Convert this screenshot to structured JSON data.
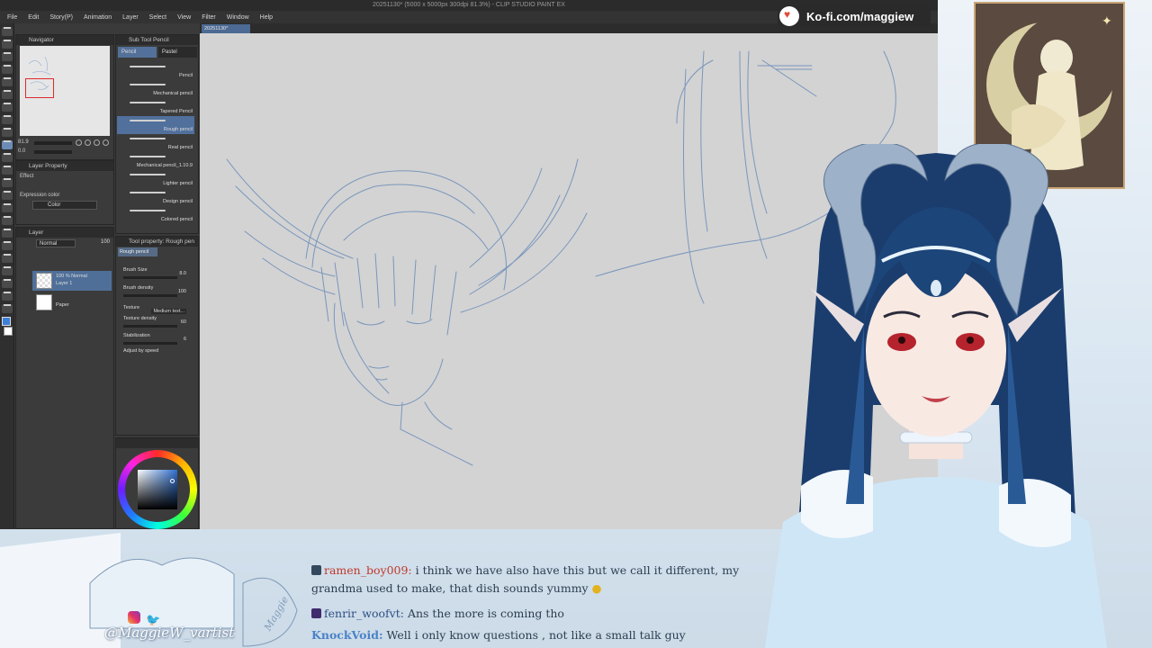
{
  "app": {
    "title": "20251130* (5000 x 5000px 300dpi 81.3%) - CLIP STUDIO PAINT EX",
    "menu": [
      "File",
      "Edit",
      "Story(P)",
      "Animation",
      "Layer",
      "Select",
      "View",
      "Filter",
      "Window",
      "Help"
    ],
    "doc_tab": "20251130*"
  },
  "navigator": {
    "title": "Navigator",
    "zoom": "81.9",
    "rotation": "0.0"
  },
  "layer_property": {
    "title": "Layer Property",
    "effect": "Effect",
    "expression_color_label": "Expression color",
    "expression_color_value": "Color"
  },
  "layer_panel": {
    "title": "Layer",
    "blend_mode": "Normal",
    "opacity": "100",
    "layers": [
      {
        "line1": "100 % Normal",
        "line2": "Layer 1"
      },
      {
        "line1": "",
        "line2": "Paper"
      }
    ]
  },
  "sub_tool": {
    "title": "Sub Tool Pencil",
    "tabs": [
      "Pencil",
      "Pastel"
    ],
    "brushes": [
      "Pencil",
      "Mechanical pencil",
      "Tapered Pencil",
      "Rough pencil",
      "Real pencil",
      "Mechanical pencil_1.10.9",
      "Lighter pencil",
      "Design pencil",
      "Colored pencil"
    ],
    "selected_index": 3
  },
  "tool_property": {
    "title": "Tool property: Rough pen",
    "preset": "Rough pencil",
    "props": [
      {
        "label": "Brush Size",
        "value": "8.0"
      },
      {
        "label": "Brush density",
        "value": "100"
      },
      {
        "label": "Texture",
        "value": "Medium text..."
      },
      {
        "label": "Texture density",
        "value": "60"
      },
      {
        "label": "Stabilization",
        "value": "6"
      }
    ],
    "adjust_by_speed": "Adjust by speed"
  },
  "overlay": {
    "kofi": "Ko-fi.com/maggiew",
    "social_handle": "@MaggieW_vartist"
  },
  "chat": [
    {
      "user": "ramen_boy009:",
      "text": "i think we have also have this but we call it different, my",
      "text2": "grandma used to make, that dish sounds yummy"
    },
    {
      "user": "fenrir_woofvt:",
      "text": "Ans the more is coming tho"
    },
    {
      "user": "KnockVoid:",
      "text": "Well i only know questions , not like a small talk guy"
    }
  ],
  "colors": {
    "accent": "#4c6a93",
    "chat_name_red": "#c0392b",
    "chat_name_blue": "#4a82c6",
    "frame": "#b9cfe2"
  }
}
